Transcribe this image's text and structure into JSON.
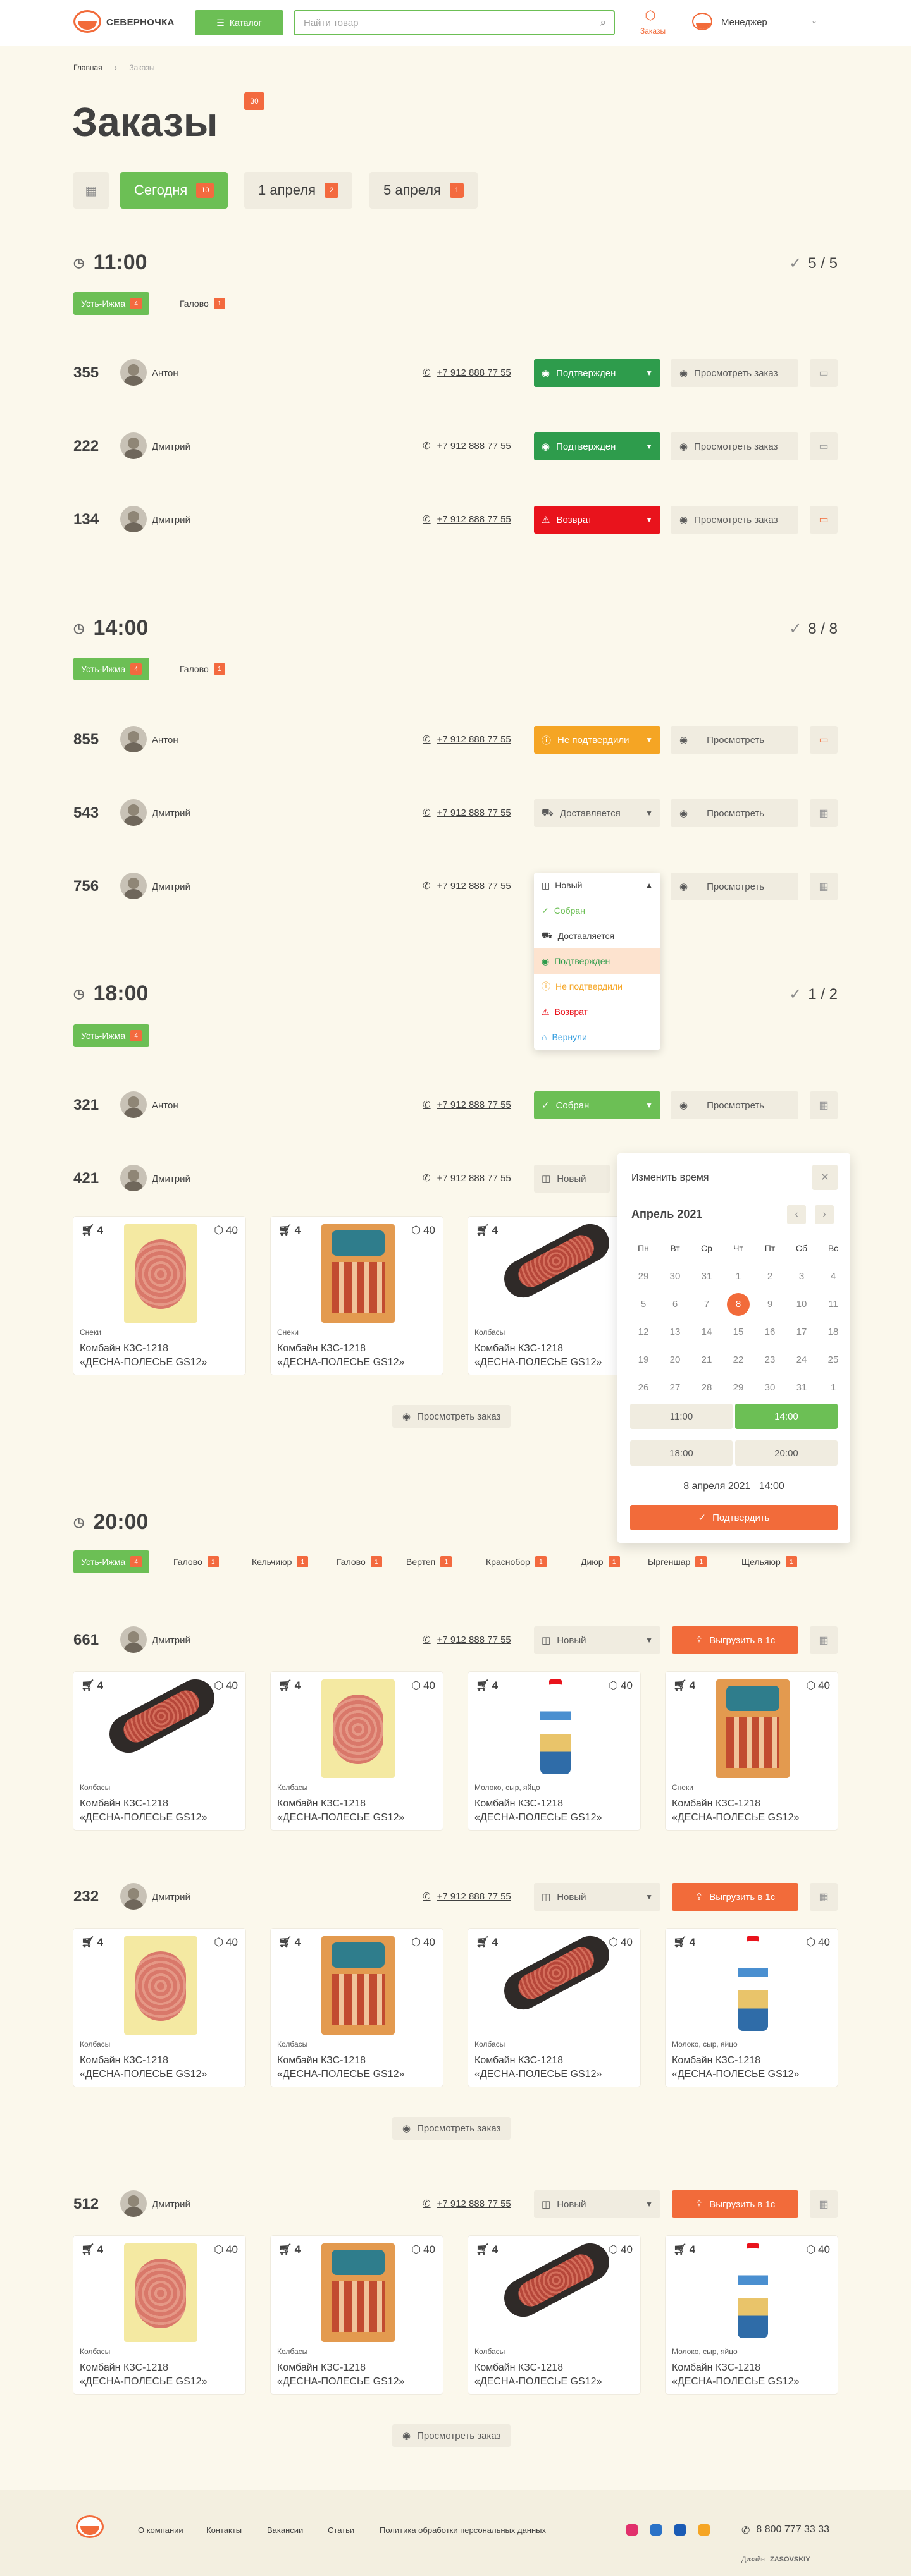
{
  "header": {
    "brand": "СЕВЕРНОЧКА",
    "catalog": "Каталог",
    "search_placeholder": "Найти товар",
    "orders": "Заказы",
    "role": "Менеджер"
  },
  "breadcrumb": {
    "home": "Главная",
    "current": "Заказы"
  },
  "page": {
    "title": "Заказы",
    "total_badge": "30"
  },
  "dates": [
    {
      "label": "Сегодня",
      "count": "10"
    },
    {
      "label": "1 апреля",
      "count": "2"
    },
    {
      "label": "5 апреля",
      "count": "1"
    }
  ],
  "slots": [
    {
      "time": "11:00",
      "count": "5 / 5",
      "pills": [
        {
          "label": "Усть-Ижма",
          "n": "4"
        },
        {
          "label": "Галово",
          "n": "1"
        }
      ],
      "orders": [
        {
          "num": "355",
          "name": "Антон",
          "phone": "+7 912 888 77 55",
          "status": "Подтвержден",
          "view": "Просмотреть заказ"
        },
        {
          "num": "222",
          "name": "Дмитрий",
          "phone": "+7 912 888 77 55",
          "status": "Подтвержден",
          "view": "Просмотреть заказ"
        },
        {
          "num": "134",
          "name": "Дмитрий",
          "phone": "+7 912 888 77 55",
          "status": "Возврат",
          "view": "Просмотреть заказ"
        }
      ]
    },
    {
      "time": "14:00",
      "count": "8 / 8",
      "pills": [
        {
          "label": "Усть-Ижма",
          "n": "4"
        },
        {
          "label": "Галово",
          "n": "1"
        }
      ],
      "orders": [
        {
          "num": "855",
          "name": "Антон",
          "phone": "+7 912 888 77 55",
          "status": "Не подтвердили",
          "view": "Просмотреть"
        },
        {
          "num": "543",
          "name": "Дмитрий",
          "phone": "+7 912 888 77 55",
          "status": "Доставляется",
          "view": "Просмотреть"
        },
        {
          "num": "756",
          "name": "Дмитрий",
          "phone": "+7 912 888 77 55",
          "status": "Новый",
          "view": "Просмотреть"
        }
      ]
    },
    {
      "time": "18:00",
      "count": "1 / 2",
      "pills": [
        {
          "label": "Усть-Ижма",
          "n": "4"
        }
      ],
      "orders": [
        {
          "num": "321",
          "name": "Антон",
          "phone": "+7 912 888 77 55",
          "status": "Собран",
          "view": "Просмотреть"
        },
        {
          "num": "421",
          "name": "Дмитрий",
          "phone": "+7 912 888 77 55",
          "status": "Новый"
        }
      ]
    },
    {
      "time": "20:00",
      "pills": [
        {
          "label": "Усть-Ижма",
          "n": "4"
        },
        {
          "label": "Галово",
          "n": "1"
        },
        {
          "label": "Кельчиюр",
          "n": "1"
        },
        {
          "label": "Галово",
          "n": "1"
        },
        {
          "label": "Вертеп",
          "n": "1"
        },
        {
          "label": "Краснобор",
          "n": "1"
        },
        {
          "label": "Диюр",
          "n": "1"
        },
        {
          "label": "Ыргеншар",
          "n": "1"
        },
        {
          "label": "Щельяюр",
          "n": "1"
        }
      ],
      "orders": [
        {
          "num": "661",
          "name": "Дмитрий",
          "phone": "+7 912 888 77 55",
          "status": "Новый",
          "upload": "Выгрузить в 1с"
        },
        {
          "num": "232",
          "name": "Дмитрий",
          "phone": "+7 912 888 77 55",
          "status": "Новый",
          "upload": "Выгрузить в 1с"
        },
        {
          "num": "512",
          "name": "Дмитрий",
          "phone": "+7 912 888 77 55",
          "status": "Новый",
          "upload": "Выгрузить в 1с"
        }
      ]
    }
  ],
  "status_menu": [
    "Новый",
    "Собран",
    "Доставляется",
    "Подтвержден",
    "Не подтвердили",
    "Возврат",
    "Вернули"
  ],
  "product": {
    "title1": "Комбайн КЗС-1218",
    "title2": "«ДЕСНА-ПОЛЕСЬЕ GS12»",
    "cart": "4",
    "box": "40",
    "cat_snacks": "Снеки",
    "cat_sausage": "Колбасы",
    "cat_milk": "Молоко, сыр, яйцо"
  },
  "view_order": "Просмотреть заказ",
  "calendar": {
    "title": "Изменить время",
    "month": "Апрель 2021",
    "weekdays": [
      "Пн",
      "Вт",
      "Ср",
      "Чт",
      "Пт",
      "Сб",
      "Вс"
    ],
    "days": [
      "29",
      "30",
      "31",
      "1",
      "2",
      "3",
      "4",
      "5",
      "6",
      "7",
      "8",
      "9",
      "10",
      "11",
      "12",
      "13",
      "14",
      "15",
      "16",
      "17",
      "18",
      "19",
      "20",
      "21",
      "22",
      "23",
      "24",
      "25",
      "26",
      "27",
      "28",
      "29",
      "30",
      "31",
      "1"
    ],
    "selected": "8",
    "times": [
      "11:00",
      "14:00",
      "18:00",
      "20:00"
    ],
    "selected_time": "14:00",
    "summary": "8 апреля 2021   14:00",
    "confirm": "Подтвердить"
  },
  "footer": {
    "links": [
      "О компании",
      "Контакты",
      "Вакансии",
      "Статьи",
      "Политика обработки персональных данных"
    ],
    "phone": "8 800 777 33 33",
    "design": "Дизайн",
    "studio": "ZASOVSKIY"
  }
}
